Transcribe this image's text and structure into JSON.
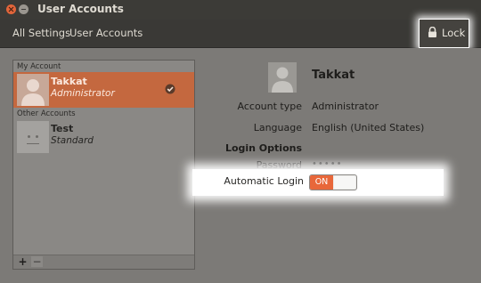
{
  "window": {
    "title": "User Accounts"
  },
  "toolbar": {
    "breadcrumbs": [
      "All Settings",
      "User Accounts"
    ],
    "lock_label": "Lock",
    "lock_icon": "lock-icon"
  },
  "accounts": {
    "my_account_header": "My Account",
    "other_accounts_header": "Other Accounts",
    "my_account": {
      "name": "Takkat",
      "type": "Administrator",
      "selected": true
    },
    "others": [
      {
        "name": "Test",
        "type": "Standard"
      }
    ],
    "add_label": "+",
    "remove_label": "−"
  },
  "details": {
    "name": "Takkat",
    "account_type_label": "Account type",
    "account_type_value": "Administrator",
    "language_label": "Language",
    "language_value": "English (United States)",
    "login_options_label": "Login Options",
    "password_label": "Password",
    "password_value": "•••••",
    "automatic_login_label": "Automatic Login",
    "automatic_login_state": "ON"
  },
  "colors": {
    "accent": "#e8673a",
    "selected_row": "#c4683f",
    "background": "#7c7a77",
    "titlebar": "#3c3b37"
  }
}
